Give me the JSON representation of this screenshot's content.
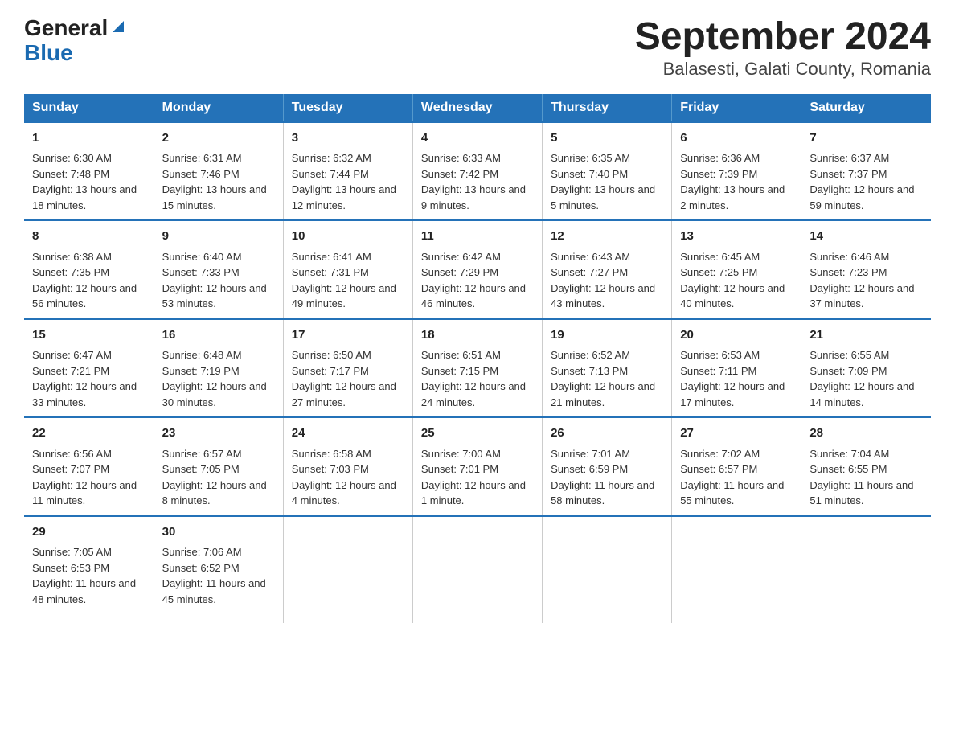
{
  "logo": {
    "general": "General",
    "blue": "Blue",
    "triangle": "▲"
  },
  "title": "September 2024",
  "subtitle": "Balasesti, Galati County, Romania",
  "header_days": [
    "Sunday",
    "Monday",
    "Tuesday",
    "Wednesday",
    "Thursday",
    "Friday",
    "Saturday"
  ],
  "weeks": [
    [
      {
        "day": "1",
        "info": "Sunrise: 6:30 AM\nSunset: 7:48 PM\nDaylight: 13 hours and 18 minutes."
      },
      {
        "day": "2",
        "info": "Sunrise: 6:31 AM\nSunset: 7:46 PM\nDaylight: 13 hours and 15 minutes."
      },
      {
        "day": "3",
        "info": "Sunrise: 6:32 AM\nSunset: 7:44 PM\nDaylight: 13 hours and 12 minutes."
      },
      {
        "day": "4",
        "info": "Sunrise: 6:33 AM\nSunset: 7:42 PM\nDaylight: 13 hours and 9 minutes."
      },
      {
        "day": "5",
        "info": "Sunrise: 6:35 AM\nSunset: 7:40 PM\nDaylight: 13 hours and 5 minutes."
      },
      {
        "day": "6",
        "info": "Sunrise: 6:36 AM\nSunset: 7:39 PM\nDaylight: 13 hours and 2 minutes."
      },
      {
        "day": "7",
        "info": "Sunrise: 6:37 AM\nSunset: 7:37 PM\nDaylight: 12 hours and 59 minutes."
      }
    ],
    [
      {
        "day": "8",
        "info": "Sunrise: 6:38 AM\nSunset: 7:35 PM\nDaylight: 12 hours and 56 minutes."
      },
      {
        "day": "9",
        "info": "Sunrise: 6:40 AM\nSunset: 7:33 PM\nDaylight: 12 hours and 53 minutes."
      },
      {
        "day": "10",
        "info": "Sunrise: 6:41 AM\nSunset: 7:31 PM\nDaylight: 12 hours and 49 minutes."
      },
      {
        "day": "11",
        "info": "Sunrise: 6:42 AM\nSunset: 7:29 PM\nDaylight: 12 hours and 46 minutes."
      },
      {
        "day": "12",
        "info": "Sunrise: 6:43 AM\nSunset: 7:27 PM\nDaylight: 12 hours and 43 minutes."
      },
      {
        "day": "13",
        "info": "Sunrise: 6:45 AM\nSunset: 7:25 PM\nDaylight: 12 hours and 40 minutes."
      },
      {
        "day": "14",
        "info": "Sunrise: 6:46 AM\nSunset: 7:23 PM\nDaylight: 12 hours and 37 minutes."
      }
    ],
    [
      {
        "day": "15",
        "info": "Sunrise: 6:47 AM\nSunset: 7:21 PM\nDaylight: 12 hours and 33 minutes."
      },
      {
        "day": "16",
        "info": "Sunrise: 6:48 AM\nSunset: 7:19 PM\nDaylight: 12 hours and 30 minutes."
      },
      {
        "day": "17",
        "info": "Sunrise: 6:50 AM\nSunset: 7:17 PM\nDaylight: 12 hours and 27 minutes."
      },
      {
        "day": "18",
        "info": "Sunrise: 6:51 AM\nSunset: 7:15 PM\nDaylight: 12 hours and 24 minutes."
      },
      {
        "day": "19",
        "info": "Sunrise: 6:52 AM\nSunset: 7:13 PM\nDaylight: 12 hours and 21 minutes."
      },
      {
        "day": "20",
        "info": "Sunrise: 6:53 AM\nSunset: 7:11 PM\nDaylight: 12 hours and 17 minutes."
      },
      {
        "day": "21",
        "info": "Sunrise: 6:55 AM\nSunset: 7:09 PM\nDaylight: 12 hours and 14 minutes."
      }
    ],
    [
      {
        "day": "22",
        "info": "Sunrise: 6:56 AM\nSunset: 7:07 PM\nDaylight: 12 hours and 11 minutes."
      },
      {
        "day": "23",
        "info": "Sunrise: 6:57 AM\nSunset: 7:05 PM\nDaylight: 12 hours and 8 minutes."
      },
      {
        "day": "24",
        "info": "Sunrise: 6:58 AM\nSunset: 7:03 PM\nDaylight: 12 hours and 4 minutes."
      },
      {
        "day": "25",
        "info": "Sunrise: 7:00 AM\nSunset: 7:01 PM\nDaylight: 12 hours and 1 minute."
      },
      {
        "day": "26",
        "info": "Sunrise: 7:01 AM\nSunset: 6:59 PM\nDaylight: 11 hours and 58 minutes."
      },
      {
        "day": "27",
        "info": "Sunrise: 7:02 AM\nSunset: 6:57 PM\nDaylight: 11 hours and 55 minutes."
      },
      {
        "day": "28",
        "info": "Sunrise: 7:04 AM\nSunset: 6:55 PM\nDaylight: 11 hours and 51 minutes."
      }
    ],
    [
      {
        "day": "29",
        "info": "Sunrise: 7:05 AM\nSunset: 6:53 PM\nDaylight: 11 hours and 48 minutes."
      },
      {
        "day": "30",
        "info": "Sunrise: 7:06 AM\nSunset: 6:52 PM\nDaylight: 11 hours and 45 minutes."
      },
      {
        "day": "",
        "info": ""
      },
      {
        "day": "",
        "info": ""
      },
      {
        "day": "",
        "info": ""
      },
      {
        "day": "",
        "info": ""
      },
      {
        "day": "",
        "info": ""
      }
    ]
  ]
}
